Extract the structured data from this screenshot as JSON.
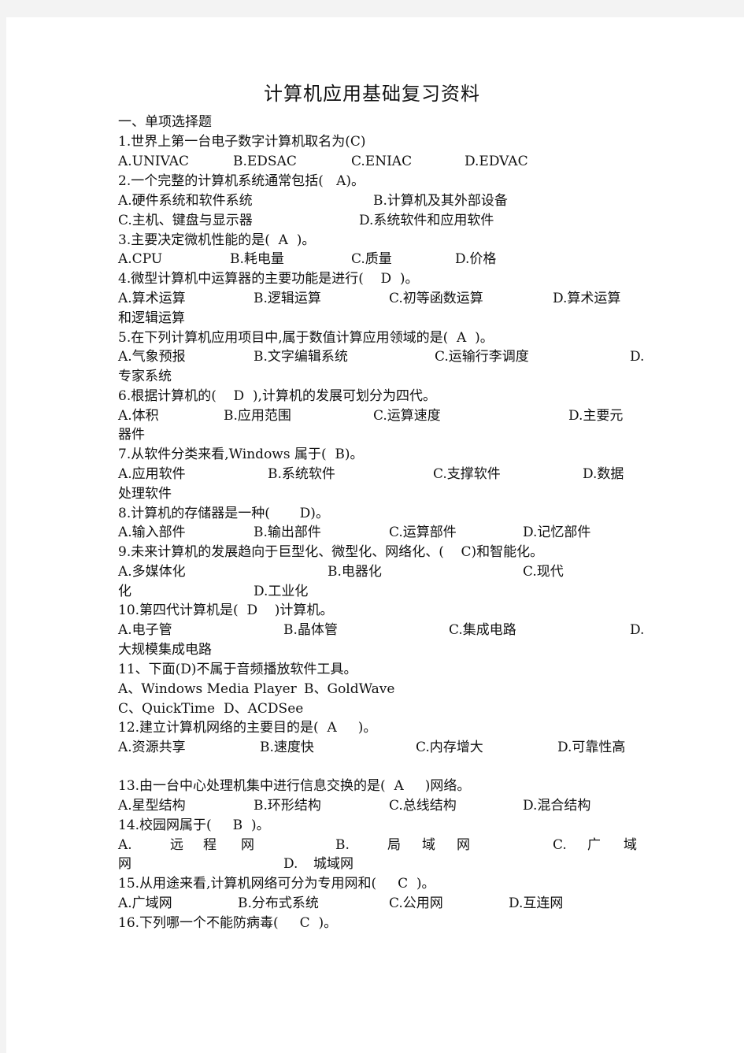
{
  "document": {
    "title": "计算机应用基础复习资料",
    "section_heading": "一、单项选择题",
    "questions": [
      {
        "stem": "1.世界上第一台电子数字计算机取名为(C)",
        "options": [
          "A.UNIVAC",
          "B.EDSAC",
          "C.ENIAC",
          "D.EDVAC"
        ]
      },
      {
        "stem": "2.一个完整的计算机系统通常包括(   A)。",
        "options": [
          "A.硬件系统和软件系统",
          "B.计算机及其外部设备",
          "C.主机、键盘与显示器",
          "D.系统软件和应用软件"
        ]
      },
      {
        "stem": "3.主要决定微机性能的是(  A  )。",
        "options": [
          "A.CPU",
          "B.耗电量",
          "C.质量",
          "D.价格"
        ]
      },
      {
        "stem": "4.微型计算机中运算器的主要功能是进行(    D  )。",
        "options": [
          "A.算术运算",
          "B.逻辑运算",
          "C.初等函数运算",
          "D.算术运算"
        ],
        "continuation": "和逻辑运算"
      },
      {
        "stem": "5.在下列计算机应用项目中,属于数值计算应用领域的是(  A  )。",
        "options": [
          "A.气象预报",
          "B.文字编辑系统",
          "C.运输行李调度",
          "D."
        ],
        "continuation": "专家系统"
      },
      {
        "stem": "6.根据计算机的(    D  ),计算机的发展可划分为四代。",
        "options": [
          "A.体积",
          "B.应用范围",
          "C.运算速度",
          "D.主要元"
        ],
        "continuation": "器件"
      },
      {
        "stem": "7.从软件分类来看,Windows 属于(  B)。",
        "options": [
          "A.应用软件",
          "B.系统软件",
          "C.支撑软件",
          "D.数据"
        ],
        "continuation": "处理软件"
      },
      {
        "stem": "8.计算机的存储器是一种(       D)。",
        "options": [
          "A.输入部件",
          "B.输出部件",
          "C.运算部件",
          "D.记忆部件"
        ]
      },
      {
        "stem": "9.未来计算机的发展趋向于巨型化、微型化、网络化、(    C)和智能化。",
        "options": [
          "A.多媒体化",
          "B.电器化",
          "C.现代",
          "D.工业化"
        ],
        "continuation": "化"
      },
      {
        "stem": "10.第四代计算机是(  D    )计算机。",
        "options": [
          "A.电子管",
          "B.晶体管",
          "C.集成电路",
          "D."
        ],
        "continuation": "大规模集成电路"
      },
      {
        "stem": "11、下面(D)不属于音频播放软件工具。",
        "options": [
          "A、Windows Media Player",
          "B、GoldWave",
          "C、QuickTime",
          "D、ACDSee"
        ]
      },
      {
        "stem": "12.建立计算机网络的主要目的是(  A     )。",
        "options": [
          "A.资源共享",
          "B.速度快",
          "C.内存增大",
          "D.可靠性高"
        ]
      },
      {
        "stem": "13.由一台中心处理机集中进行信息交换的是(  A     )网络。",
        "options": [
          "A.星型结构",
          "B.环形结构",
          "C.总线结构",
          "D.混合结构"
        ]
      },
      {
        "stem": "14.校园网属于(     B  )。",
        "options": [
          "A.",
          "远",
          "程",
          "网",
          "B.",
          "局",
          "域",
          "网",
          "C.",
          "广",
          "域",
          "网",
          "D.",
          "城域网"
        ]
      },
      {
        "stem": "15.从用途来看,计算机网络可分为专用网和(     C  )。",
        "options": [
          "A.广域网",
          "B.分布式系统",
          "C.公用网",
          "D.互连网"
        ]
      },
      {
        "stem": "16.下列哪一个不能防病毒(     C  )。"
      }
    ]
  }
}
